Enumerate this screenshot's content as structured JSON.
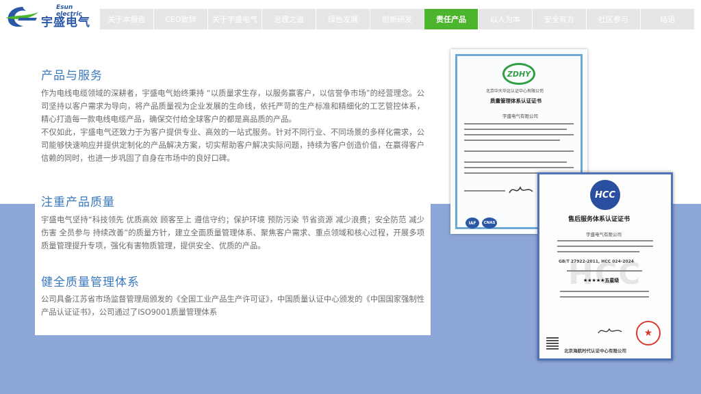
{
  "brand": {
    "name_en": "Esun electric",
    "name_cn": "宇盛电气",
    "colors": {
      "primary": "#2a57a6",
      "leaf": "#4ab52d",
      "band": "#8da6d8",
      "heading": "#3a78bf"
    }
  },
  "nav": {
    "tabs": [
      {
        "label": "关于本报告"
      },
      {
        "label": "CEO致辞"
      },
      {
        "label": "关于宇盛电气"
      },
      {
        "label": "治理之道"
      },
      {
        "label": "绿色发展"
      },
      {
        "label": "创新研发"
      },
      {
        "label": "责任产品",
        "active": true
      },
      {
        "label": "以人为本"
      },
      {
        "label": "安全有方"
      },
      {
        "label": "社区参与"
      },
      {
        "label": "结语"
      }
    ]
  },
  "sections": {
    "product_service": {
      "title": "产品与服务",
      "p1": "作为电线电缆领域的深耕者，宇盛电气始终秉持 “以质量求生存，以服务赢客户，以信誉争市场”的经营理念。公司坚持以客户需求为导向，将产品质量视为企业发展的生命线，依托严苛的生产标准和精细化的工艺管控体系，精心打造每一款电线电缆产品，确保交付给全球客户的都是高品质的产品。",
      "p2": "不仅如此，宇盛电气还致力于为客户提供专业、高效的一站式服务。针对不同行业、不同场景的多样化需求，公司能够快速响应并提供定制化的产品解决方案，切实帮助客户解决实际问题，持续为客户创造价值，在赢得客户信赖的同时，也进一步巩固了自身在市场中的良好口碑。"
    },
    "quality_focus": {
      "title": "注重产品质量",
      "p1": "宇盛电气坚持“科技领先 优质高效 顾客至上 遵信守约；保护环境 预防污染 节省资源 减少浪费；安全防范 减少伤害 全员参与 持续改善”的质量方针，建立全面质量管理体系、聚焦客户需求、重点领域和核心过程，开展多项质量管理提升专项，强化有害物质管理，提供安全、优质的产品。"
    },
    "quality_system": {
      "title": "健全质量管理体系",
      "p1": "公司具备江苏省市场监督管理局颁发的《全国工业产品生产许可证》，中国质量认证中心颁发的《中国国家强制性产品认证证书》，公司通过了ISO9001质量管理体系"
    }
  },
  "certificates": {
    "qms": {
      "logo": "ZDHY",
      "issuer": "北京中大华远认证中心有限公司",
      "title": "质量管理体系认证证书",
      "holder": "宇盛电气有限公司",
      "marks": [
        "IAF",
        "CNAS"
      ]
    },
    "after_sales": {
      "logo": "HCC",
      "title": "售后服务体系认证证书",
      "holder": "宇盛电气有限公司",
      "standard": "GB/T 27922-2011, HCC 024-2024",
      "rating": "★★★★★五星级",
      "issuer": "北京海航时代认证中心有限公司"
    }
  }
}
